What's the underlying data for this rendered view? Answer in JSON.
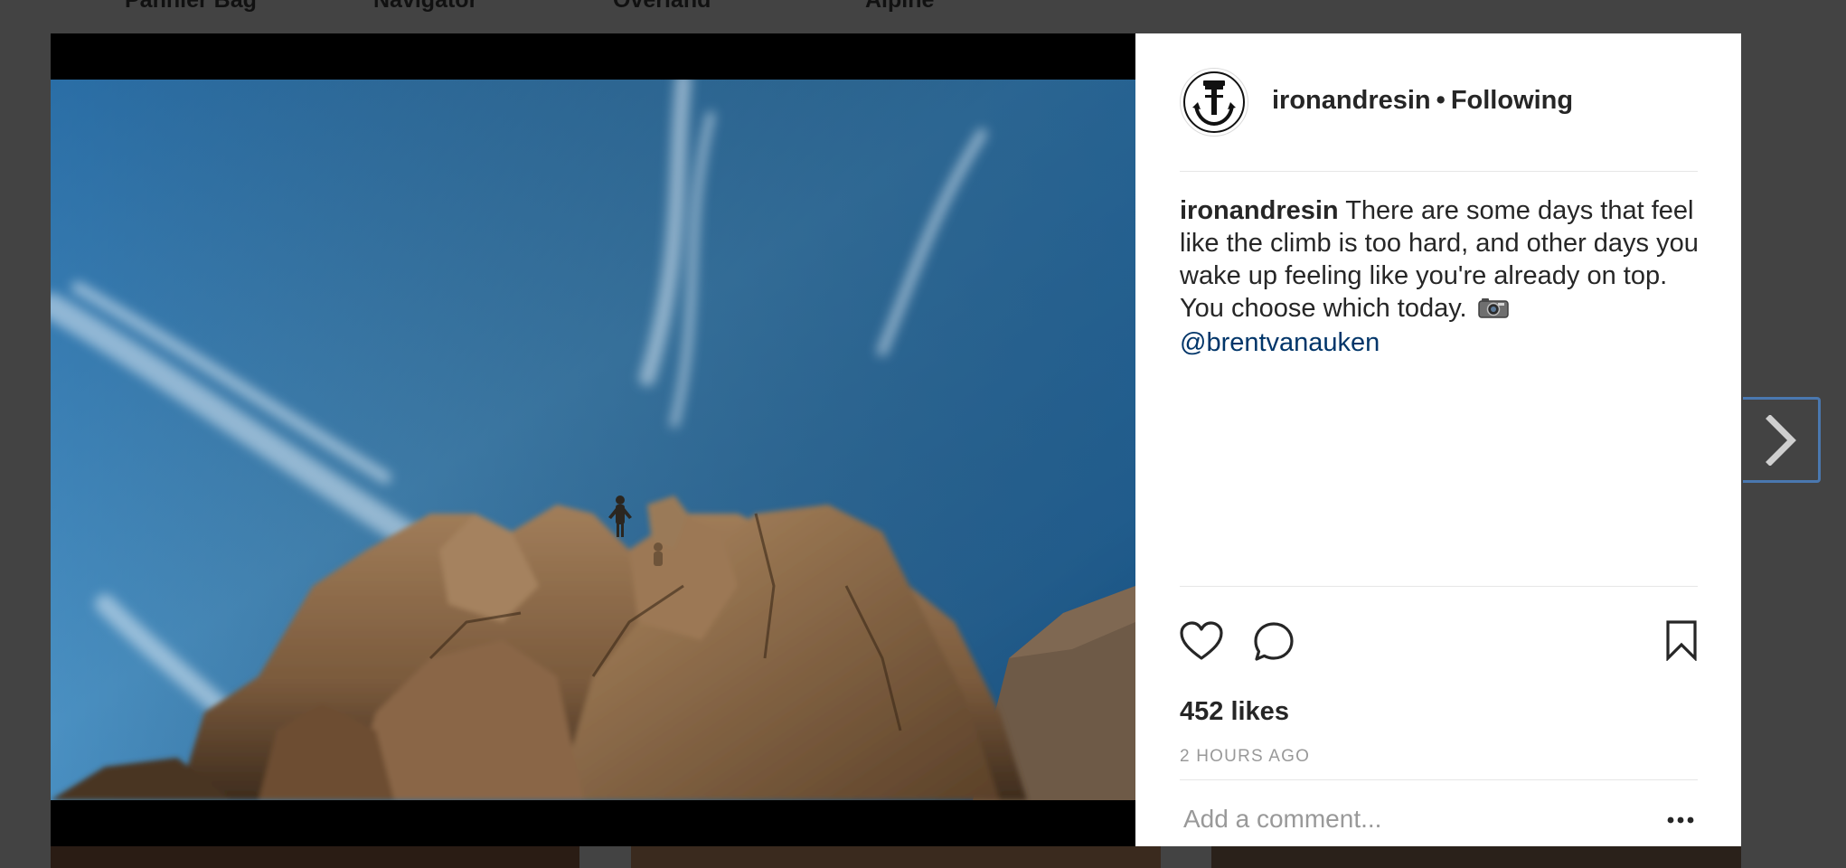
{
  "background_nav": {
    "items": [
      "Pannier Bag",
      "Navigator",
      "Overland",
      "Alpine"
    ]
  },
  "post": {
    "header": {
      "username": "ironandresin",
      "separator": "•",
      "follow_status": "Following"
    },
    "caption": {
      "username": "ironandresin",
      "text": "There are some days that feel like the climb is too hard, and other days you wake up feeling like you're already on top. You choose which today.",
      "emoji": "camera-icon",
      "mention": "@brentvanauken"
    },
    "likes": "452 likes",
    "timestamp": "2 HOURS AGO",
    "comment": {
      "placeholder": "Add a comment...",
      "value": ""
    },
    "actions": {
      "like_icon": "heart-icon",
      "comment_icon": "speech-bubble-icon",
      "save_icon": "bookmark-icon",
      "more_icon": "ellipsis-icon"
    }
  },
  "navigation": {
    "next_icon": "chevron-right-icon"
  },
  "colors": {
    "overlay": "#434343",
    "panel_bg": "#ffffff",
    "text_primary": "#262626",
    "text_secondary": "#999999",
    "mention_link": "#003569",
    "next_button_border": "#4a78b0",
    "divider": "#e6e6e6"
  }
}
